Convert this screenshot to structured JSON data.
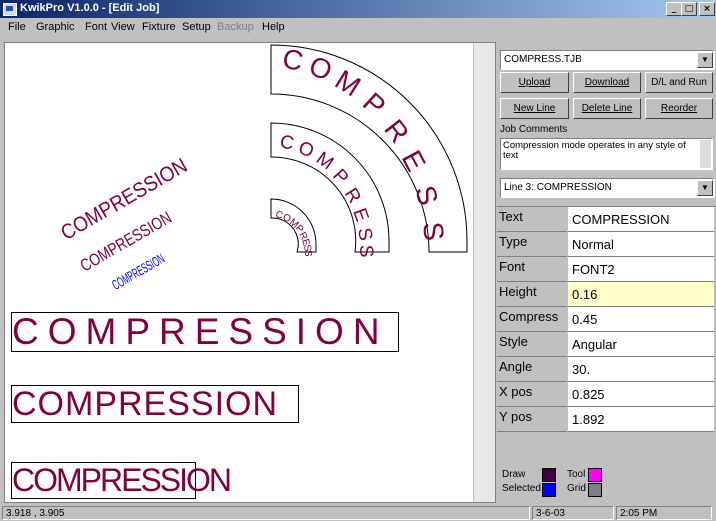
{
  "window": {
    "title": "KwikPro  V1.0.0 - [Edit Job]"
  },
  "menu": {
    "file": "File",
    "graphic": "Graphic",
    "font": "Font",
    "view": "View",
    "fixture": "Fixture",
    "setup": "Setup",
    "backup": "Backup",
    "help": "Help"
  },
  "panel": {
    "file_combo": "COMPRESS.TJB",
    "upload": "Upload",
    "download": "Download",
    "dl_run": "D/L and Run",
    "new_line": "New Line",
    "delete_line": "Delete Line",
    "reorder": "Reorder",
    "job_comments_label": "Job Comments",
    "job_comments": "Compression mode operates in any style of text",
    "line_combo": "Line 3: COMPRESSION",
    "props": [
      {
        "key": "Text",
        "value": "COMPRESSION"
      },
      {
        "key": "Type",
        "value": "Normal"
      },
      {
        "key": "Font",
        "value": "FONT2"
      },
      {
        "key": "Height",
        "value": "0.16"
      },
      {
        "key": "Compress",
        "value": "0.45"
      },
      {
        "key": "Style",
        "value": "Angular"
      },
      {
        "key": "Angle",
        "value": "30."
      },
      {
        "key": "X pos",
        "value": "0.825"
      },
      {
        "key": "Y pos",
        "value": "1.892"
      }
    ],
    "legend": {
      "draw": "Draw",
      "selected": "Selected",
      "tool": "Tool",
      "grid": "Grid"
    },
    "colors": {
      "draw": "#400040",
      "selected": "#0000ff",
      "tool": "#ff00ff",
      "grid": "#808080"
    }
  },
  "canvas": {
    "angled": [
      "COMPRESSION",
      "COMPRESSION",
      "COMPRESSION"
    ],
    "arcs": [
      "COMPRESS",
      "COMPRESS",
      "COMPRESS"
    ],
    "boxed": [
      "COMPRESSION",
      "COMPRESSION",
      "COMPRESSION"
    ]
  },
  "status": {
    "coords": "3.918 , 3.905",
    "date": "3-6-03",
    "time": "2:05 PM"
  }
}
